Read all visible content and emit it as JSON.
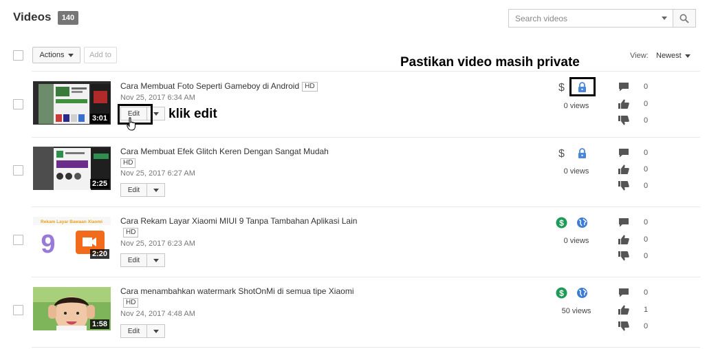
{
  "header": {
    "title": "Videos",
    "video_count": "140",
    "search_placeholder": "Search videos"
  },
  "toolbar": {
    "actions_label": "Actions",
    "add_to_label": "Add to",
    "view_label": "View:",
    "sort_value": "Newest"
  },
  "videos": [
    {
      "title": "Cara Membuat Foto Seperti Gameboy di Android",
      "hd": "HD",
      "date": "Nov 25, 2017 6:34 AM",
      "duration": "3:01",
      "edit_label": "Edit",
      "monetization": "off",
      "visibility": "private",
      "views": "0 views",
      "comments": "0",
      "likes": "0",
      "dislikes": "0"
    },
    {
      "title": "Cara Membuat Efek Glitch Keren Dengan Sangat Mudah",
      "hd": "HD",
      "date": "Nov 25, 2017 6:27 AM",
      "duration": "2:25",
      "edit_label": "Edit",
      "monetization": "off",
      "visibility": "private",
      "views": "0 views",
      "comments": "0",
      "likes": "0",
      "dislikes": "0"
    },
    {
      "title": "Cara Rekam Layar Xiaomi MIUI 9 Tanpa Tambahan Aplikasi Lain",
      "hd": "HD",
      "date": "Nov 25, 2017 6:23 AM",
      "duration": "2:20",
      "thumb_caption": "Rekam Layar Bawaan Xiaomi",
      "edit_label": "Edit",
      "monetization": "on",
      "visibility": "public",
      "views": "0 views",
      "comments": "0",
      "likes": "0",
      "dislikes": "0"
    },
    {
      "title": "Cara menambahkan watermark ShotOnMi di semua tipe Xiaomi",
      "hd": "HD",
      "date": "Nov 24, 2017 4:48 AM",
      "duration": "1:58",
      "edit_label": "Edit",
      "monetization": "on",
      "visibility": "public",
      "views": "50 views",
      "comments": "0",
      "likes": "1",
      "dislikes": "0"
    }
  ],
  "annotations": {
    "private_note": "Pastikan video masih private",
    "edit_note": "klik edit"
  },
  "icons": {
    "search": "search-icon",
    "dollar_off": "dollar-icon",
    "dollar_on": "monetized-icon",
    "lock": "lock-icon",
    "globe": "globe-icon",
    "comment": "comment-icon",
    "like": "thumbs-up-icon",
    "dislike": "thumbs-down-icon"
  },
  "colors": {
    "lock_blue": "#4a87d8",
    "monetized_green": "#1e9b57",
    "globe_blue": "#3d7bd4",
    "stat_icon": "#555555",
    "count_badge": "#767676"
  }
}
